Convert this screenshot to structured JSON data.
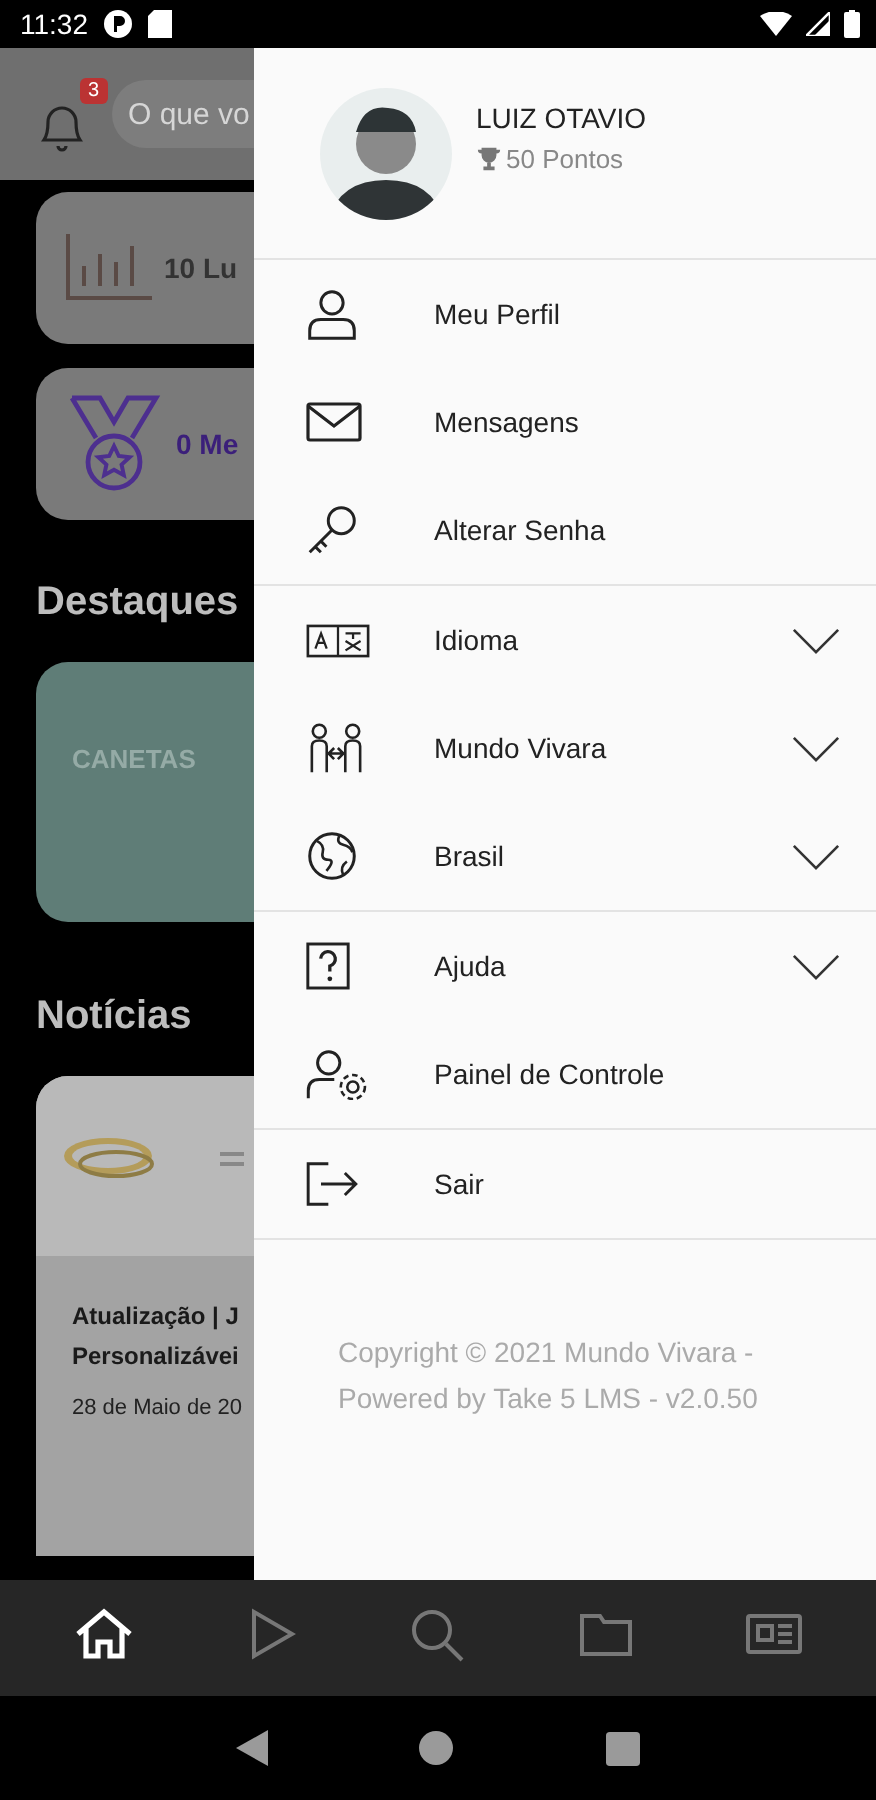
{
  "status_bar": {
    "time": "11:32"
  },
  "background": {
    "search": {
      "placeholder": "O que vo",
      "badge": "3"
    },
    "stats": [
      {
        "text": "10 Lu",
        "kind": "chart"
      },
      {
        "text": "0 Me",
        "kind": "medal"
      }
    ],
    "highlights": {
      "title": "Destaques",
      "card": "CANETAS"
    },
    "news": {
      "title": "Notícias",
      "card": {
        "kind": "picture",
        "headline": [
          "Atualização | J",
          "Personalizávei"
        ],
        "date": "28 de Maio de 20"
      }
    }
  },
  "drawer": {
    "user": {
      "name": "LUIZ OTAVIO",
      "points": "50 Pontos"
    },
    "groups": [
      [
        {
          "label": "Meu Perfil",
          "kind": "link"
        },
        {
          "label": "Mensagens",
          "kind": "link"
        },
        {
          "label": "Alterar Senha",
          "kind": "link"
        }
      ],
      [
        {
          "label": "Idioma",
          "kind": "expandable",
          "expanded": false
        },
        {
          "label": "Mundo Vivara",
          "kind": "expandable",
          "expanded": false
        },
        {
          "label": "Brasil",
          "kind": "expandable",
          "expanded": false
        }
      ],
      [
        {
          "label": "Ajuda",
          "kind": "expandable",
          "expanded": false
        },
        {
          "label": "Painel de Controle",
          "kind": "link"
        }
      ],
      [
        {
          "label": "Sair",
          "kind": "link"
        }
      ]
    ],
    "footer": [
      "Copyright © 2021 Mundo Vivara -",
      "Powered by Take 5 LMS - v2.0.50"
    ]
  },
  "bottom_nav": [
    {
      "selected": true
    },
    {
      "selected": false
    },
    {
      "selected": false
    },
    {
      "selected": false
    },
    {
      "selected": false
    }
  ]
}
